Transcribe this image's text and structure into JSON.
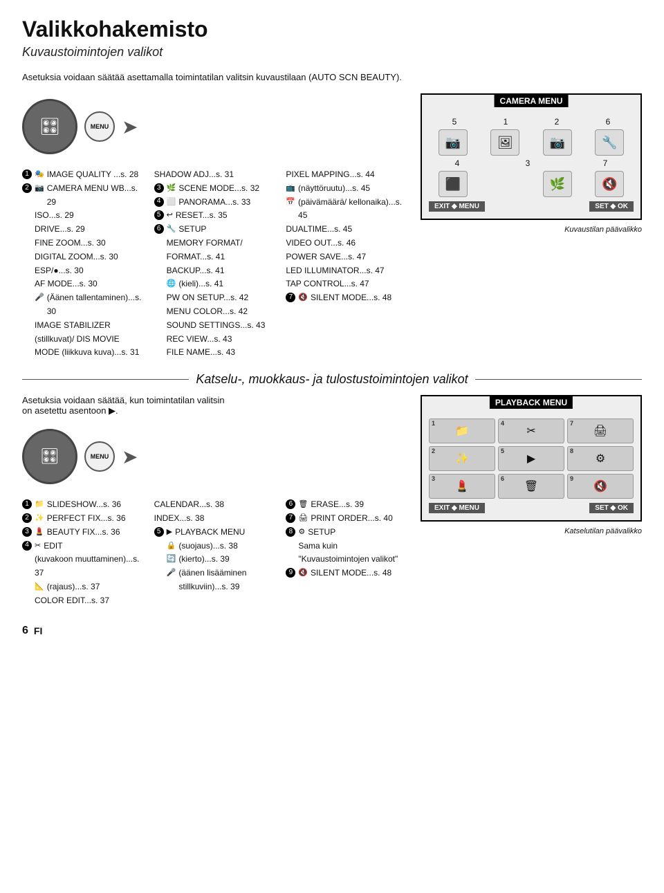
{
  "page": {
    "title": "Valikkohakemisto",
    "subtitle": "Kuvaustoimintojen valikot",
    "intro": "Asetuksia voidaan säätää asettamalla toimintatilan valitsin kuvaustilaan (AUTO SCN BEAUTY).",
    "camera_menu_label": "CAMERA MENU",
    "menu_label": "MENU",
    "exit_label": "EXIT ◆ MENU",
    "set_label": "SET ◆ OK",
    "kuvaustilan_label": "Kuvaustilan päävalikko"
  },
  "camera_menu": {
    "col1": [
      {
        "num": "1",
        "icon": "🎭",
        "text": "IMAGE QUALITY ...s. 28"
      },
      {
        "num": "2",
        "icon": "📷",
        "text": "CAMERA MENU WB...s. 29"
      },
      {
        "num": "",
        "icon": "",
        "text": "ISO...s. 29"
      },
      {
        "num": "",
        "icon": "",
        "text": "DRIVE...s. 29"
      },
      {
        "num": "",
        "icon": "",
        "text": "FINE ZOOM...s. 30"
      },
      {
        "num": "",
        "icon": "",
        "text": "DIGITAL ZOOM...s. 30"
      },
      {
        "num": "",
        "icon": "",
        "text": "ESP/●...s. 30"
      },
      {
        "num": "",
        "icon": "",
        "text": "AF MODE...s. 30"
      },
      {
        "num": "",
        "icon": "🎤",
        "text": "(Äänen tallentaminen)...s. 30"
      },
      {
        "num": "",
        "icon": "",
        "text": "IMAGE STABILIZER (stillkuvat)/ DIS MOVIE MODE (liikkuva kuva)...s. 31"
      }
    ],
    "col2": [
      {
        "num": "",
        "icon": "",
        "text": "SHADOW ADJ...s. 31"
      },
      {
        "num": "3",
        "icon": "🌿",
        "text": "SCENE MODE...s. 32"
      },
      {
        "num": "4",
        "icon": "⬜",
        "text": "PANORAMA...s. 33"
      },
      {
        "num": "5",
        "icon": "↩",
        "text": "RESET...s. 35"
      },
      {
        "num": "6",
        "icon": "🔧",
        "text": "SETUP"
      },
      {
        "num": "",
        "icon": "",
        "text": "MEMORY FORMAT/ FORMAT...s. 41"
      },
      {
        "num": "",
        "icon": "",
        "text": "BACKUP...s. 41"
      },
      {
        "num": "",
        "icon": "🌐",
        "text": "(kieli)...s. 41"
      },
      {
        "num": "",
        "icon": "",
        "text": "PW ON SETUP...s. 42"
      },
      {
        "num": "",
        "icon": "",
        "text": "MENU COLOR...s. 42"
      },
      {
        "num": "",
        "icon": "",
        "text": "SOUND SETTINGS...s. 43"
      },
      {
        "num": "",
        "icon": "",
        "text": "REC VIEW...s. 43"
      },
      {
        "num": "",
        "icon": "",
        "text": "FILE NAME...s. 43"
      }
    ],
    "col3": [
      {
        "num": "",
        "icon": "",
        "text": "PIXEL MAPPING...s. 44"
      },
      {
        "num": "",
        "icon": "📺",
        "text": "(näyttöruutu)...s. 45"
      },
      {
        "num": "",
        "icon": "📅",
        "text": "(päivämäärä/ kellonaika)...s. 45"
      },
      {
        "num": "",
        "icon": "",
        "text": "DUALTIME...s. 45"
      },
      {
        "num": "",
        "icon": "",
        "text": "VIDEO OUT...s. 46"
      },
      {
        "num": "",
        "icon": "",
        "text": "POWER SAVE...s. 47"
      },
      {
        "num": "",
        "icon": "",
        "text": "LED ILLUMINATOR...s. 47"
      },
      {
        "num": "",
        "icon": "",
        "text": "TAP CONTROL...s. 47"
      },
      {
        "num": "7",
        "icon": "🔇",
        "text": "SILENT MODE...s. 48"
      }
    ]
  },
  "diagram": {
    "title": "CAMERA MENU",
    "numbers_top": [
      "5",
      "1",
      "2",
      "6"
    ],
    "numbers_bottom": [
      "4",
      "3",
      "7"
    ],
    "exit": "EXIT ◆ MENU",
    "set": "SET ◆ OK"
  },
  "divider": {
    "title": "Katselu-, muokkaus- ja tulostustoimintojen valikot"
  },
  "playback": {
    "intro1": "Asetuksia voidaan säätää, kun toimintatilan valitsin",
    "intro2": "on asetettu asentoon ▶.",
    "menu_label": "MENU",
    "diagram_title": "PLAYBACK MENU",
    "exit_label": "EXIT ◆ MENU",
    "set_label": "SET ◆ OK",
    "katselutilan_label": "Katselutilan päävalikko"
  },
  "playback_menu": {
    "col1": [
      {
        "num": "1",
        "icon": "📁",
        "text": "SLIDESHOW...s. 36"
      },
      {
        "num": "2",
        "icon": "✨",
        "text": "PERFECT FIX...s. 36"
      },
      {
        "num": "3",
        "icon": "💄",
        "text": "BEAUTY FIX...s. 36"
      },
      {
        "num": "4",
        "icon": "✂",
        "text": "EDIT"
      },
      {
        "num": "",
        "icon": "",
        "text": "(kuvakoon muuttaminen)...s. 37"
      },
      {
        "num": "",
        "icon": "📐",
        "text": "(rajaus)...s. 37"
      },
      {
        "num": "",
        "icon": "",
        "text": "COLOR EDIT...s. 37"
      }
    ],
    "col2": [
      {
        "num": "",
        "icon": "",
        "text": "CALENDAR...s. 38"
      },
      {
        "num": "",
        "icon": "",
        "text": "INDEX...s. 38"
      },
      {
        "num": "5",
        "icon": "▶",
        "text": "PLAYBACK MENU"
      },
      {
        "num": "",
        "icon": "🔒",
        "text": "(suojaus)...s. 38"
      },
      {
        "num": "",
        "icon": "🔄",
        "text": "(kierto)...s. 39"
      },
      {
        "num": "",
        "icon": "🎤",
        "text": "(äänen lisääminen stillkuviin)...s. 39"
      }
    ],
    "col3": [
      {
        "num": "6",
        "icon": "🗑",
        "text": "ERASE...s. 39"
      },
      {
        "num": "7",
        "icon": "🖨",
        "text": "PRINT ORDER...s. 40"
      },
      {
        "num": "8",
        "icon": "⚙",
        "text": "SETUP"
      },
      {
        "num": "",
        "icon": "",
        "text": "Sama kuin \"Kuvaustoimintojen valikot\""
      },
      {
        "num": "9",
        "icon": "🔇",
        "text": "SILENT MODE...s. 48"
      }
    ]
  },
  "footer": {
    "page_num": "6",
    "lang": "FI"
  }
}
